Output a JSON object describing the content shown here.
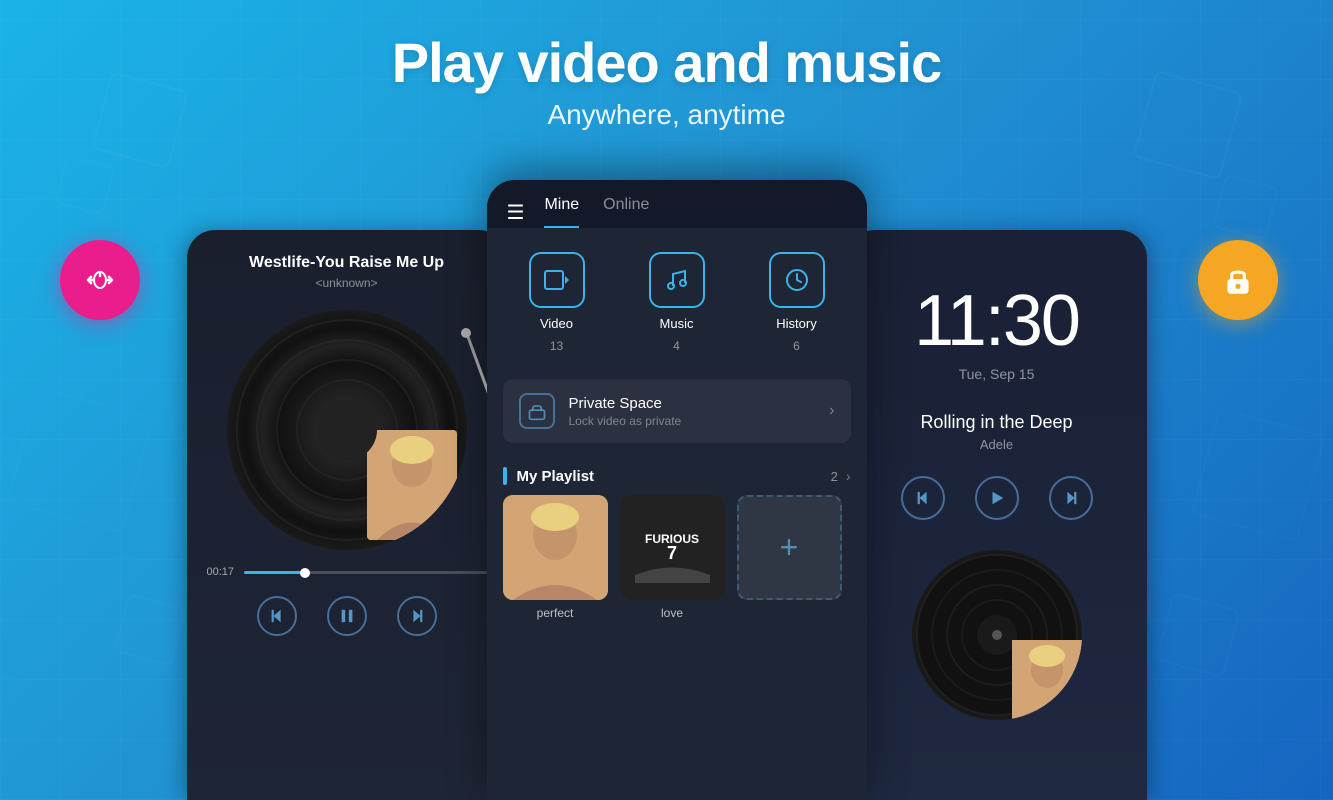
{
  "header": {
    "title": "Play video and music",
    "subtitle": "Anywhere, anytime"
  },
  "float_left": {
    "label": "gesture-icon",
    "color": "#e91e8c"
  },
  "float_right": {
    "label": "lock-icon",
    "color": "#f5a623"
  },
  "left_phone": {
    "song_title": "Westlife-You Raise Me Up",
    "song_artist": "<unknown>",
    "progress_time": "00:17",
    "controls": {
      "prev": "⏮",
      "pause": "⏸",
      "next": "⏭"
    }
  },
  "center_phone": {
    "header": {
      "hamburger": "☰",
      "tabs": [
        {
          "label": "Mine",
          "active": true
        },
        {
          "label": "Online",
          "active": false
        }
      ]
    },
    "media_sections": [
      {
        "icon": "video",
        "label": "Video",
        "count": "13"
      },
      {
        "icon": "music",
        "label": "Music",
        "count": "4"
      },
      {
        "icon": "history",
        "label": "History",
        "count": "6"
      }
    ],
    "private_space": {
      "title": "Private Space",
      "subtitle": "Lock video as private"
    },
    "playlist": {
      "title": "My Playlist",
      "count": "2",
      "items": [
        {
          "label": "perfect",
          "type": "photo"
        },
        {
          "label": "love",
          "type": "movie"
        },
        {
          "label": "",
          "type": "add"
        }
      ]
    }
  },
  "right_phone": {
    "time": "11:30",
    "date": "Tue, Sep 15",
    "song_title": "Rolling in the Deep",
    "artist": "Adele",
    "controls": {
      "prev": "⏮",
      "play": "▶",
      "next": "⏭"
    }
  }
}
